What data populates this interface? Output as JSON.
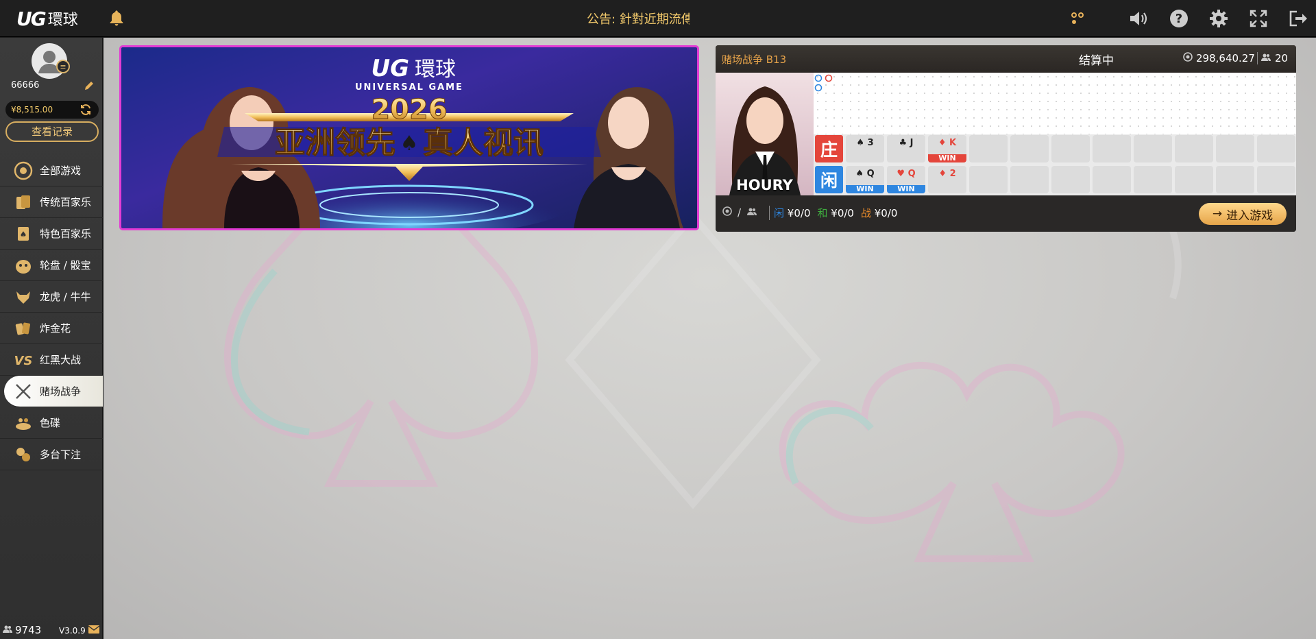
{
  "header": {
    "logo_latin": "UG",
    "logo_cn": "環球",
    "notice": "公告: 針對近期流傳",
    "icons": [
      "bell-icon",
      "apps-icon",
      "volume-icon",
      "help-icon",
      "settings-icon",
      "fullscreen-icon",
      "logout-icon"
    ]
  },
  "user": {
    "name": "66666",
    "balance": "¥8,515.00",
    "records_label": "查看记录"
  },
  "nav": [
    {
      "label": "全部游戏",
      "icon": "all-games-icon"
    },
    {
      "label": "传统百家乐",
      "icon": "classic-baccarat-icon"
    },
    {
      "label": "特色百家乐",
      "icon": "special-baccarat-icon"
    },
    {
      "label": "轮盘 / 骰宝",
      "icon": "roulette-sicbo-icon"
    },
    {
      "label": "龙虎 / 牛牛",
      "icon": "dragon-tiger-icon"
    },
    {
      "label": "炸金花",
      "icon": "golden-flower-icon"
    },
    {
      "label": "红黑大战",
      "icon": "red-black-icon"
    },
    {
      "label": "赌场战争",
      "icon": "casino-war-icon",
      "active": true
    },
    {
      "label": "色碟",
      "icon": "sedie-icon"
    },
    {
      "label": "多台下注",
      "icon": "multi-table-icon"
    }
  ],
  "footer": {
    "online_count": "9743",
    "version": "V3.0.9"
  },
  "banner": {
    "logo_latin": "UG",
    "logo_cn": "環球",
    "subtitle": "UNIVERSAL GAME",
    "year": "2026",
    "headline_left": "亚洲领先",
    "headline_right": "真人视讯"
  },
  "game_card": {
    "title": "赌场战争 B13",
    "status": "结算中",
    "pool": "298,640.27",
    "players": "20",
    "dealer_name": "HOURY",
    "banker_label": "庄",
    "player_label": "闲",
    "banker_cards": [
      {
        "suit": "♠",
        "rank": "3",
        "red": false,
        "win": false
      },
      {
        "suit": "♣",
        "rank": "J",
        "red": false,
        "win": false
      },
      {
        "suit": "♦",
        "rank": "K",
        "red": true,
        "win": true
      }
    ],
    "player_cards": [
      {
        "suit": "♠",
        "rank": "Q",
        "red": false,
        "win": true
      },
      {
        "suit": "♥",
        "rank": "Q",
        "red": true,
        "win": true
      },
      {
        "suit": "♦",
        "rank": "2",
        "red": true,
        "win": false
      }
    ],
    "win_label": "WIN",
    "bets": {
      "player_label": "闲",
      "player_value": "¥0/0",
      "tie_label": "和",
      "tie_value": "¥0/0",
      "war_label": "战",
      "war_value": "¥0/0"
    },
    "enter_label": "进入游戏",
    "colors": {
      "banker": "#e4453b",
      "player": "#2e86e0",
      "tie": "#3fae3f",
      "war": "#e98b2a"
    }
  }
}
